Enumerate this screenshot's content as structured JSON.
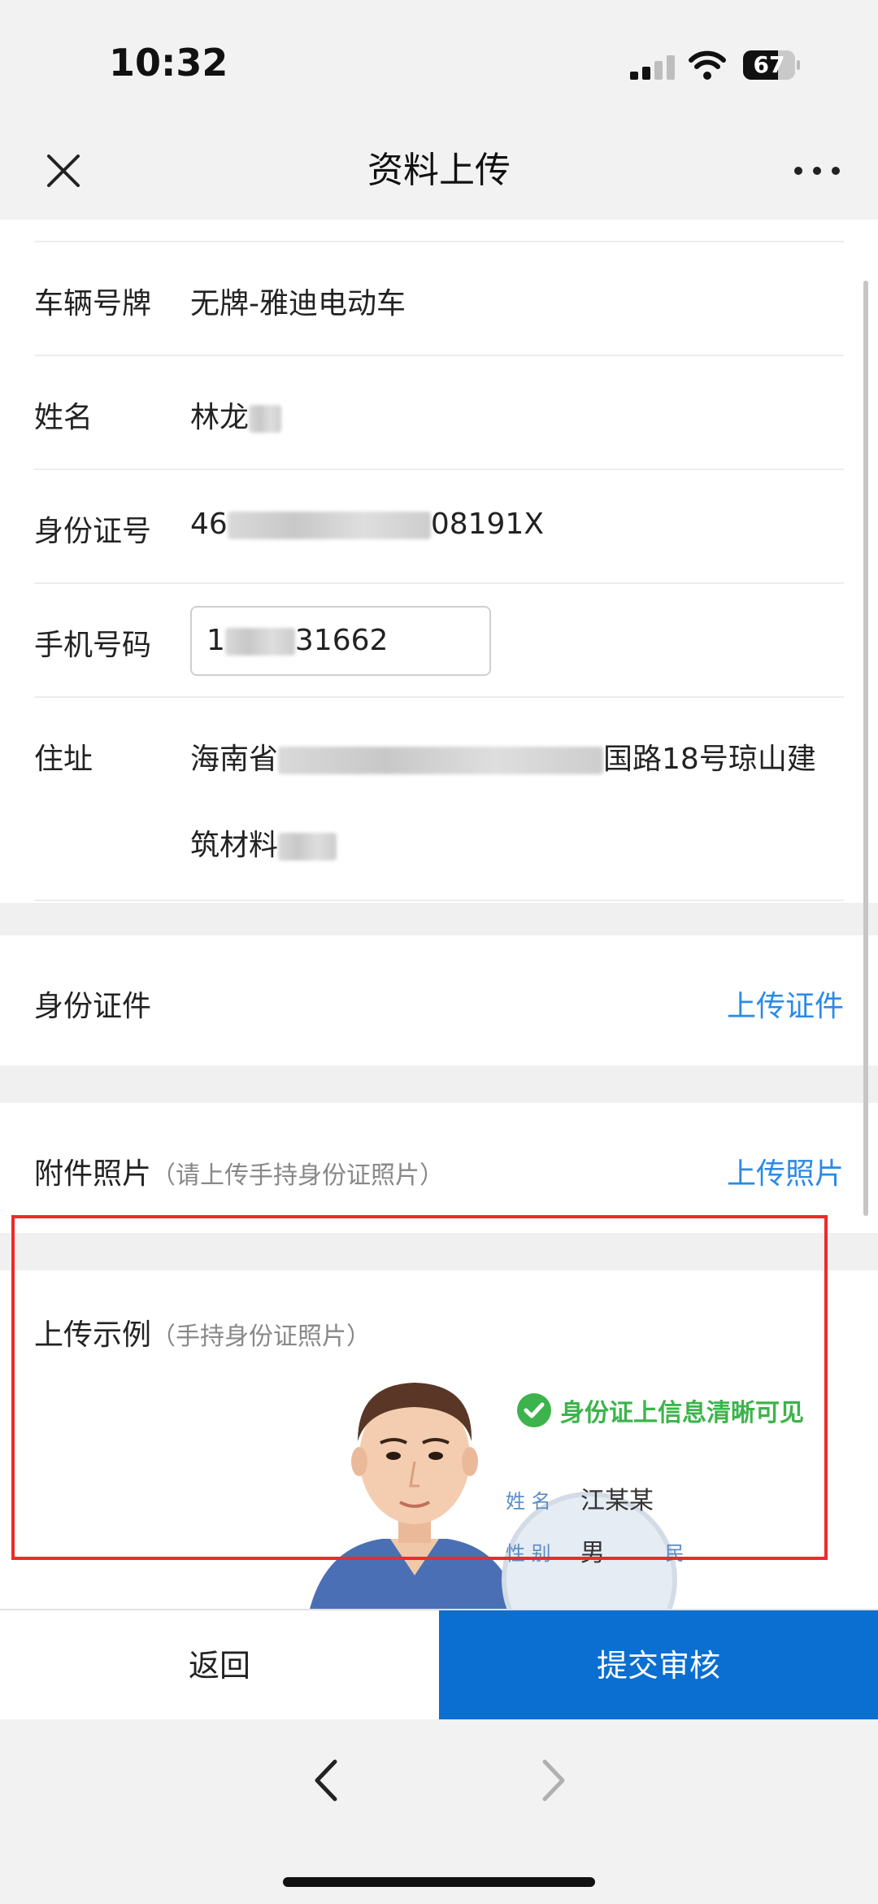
{
  "status_bar": {
    "time": "10:32",
    "battery": "67",
    "battery_level": 0.67
  },
  "nav": {
    "title": "资料上传"
  },
  "form": {
    "plate": {
      "label": "车辆号牌",
      "value": "无牌-雅迪电动车"
    },
    "name": {
      "label": "姓名",
      "value_visible": "林龙"
    },
    "id_number": {
      "label": "身份证号",
      "prefix": "46",
      "suffix": "08191X"
    },
    "phone": {
      "label": "手机号码",
      "prefix": "1",
      "suffix": "31662"
    },
    "address": {
      "label": "住址",
      "line1_prefix": "海南省",
      "line1_suffix": "国路18号琼山建",
      "line2_prefix": "筑材料"
    }
  },
  "id_doc": {
    "label": "身份证件",
    "action": "上传证件"
  },
  "attachment": {
    "label": "附件照片",
    "hint": "（请上传手持身份证照片）",
    "action": "上传照片"
  },
  "example": {
    "label": "上传示例",
    "hint": "（手持身份证照片）",
    "check_text": "身份证上信息清晰可见",
    "card_name_label": "姓 名",
    "card_name_value": "江某某",
    "card_gender_label": "性 别",
    "card_gender_value": "男",
    "card_ethnicity_label": "民"
  },
  "bottom": {
    "back": "返回",
    "submit": "提交审核"
  },
  "colors": {
    "accent": "#0a6fd0",
    "link": "#2a8ae6",
    "highlight": "#ee2a2a",
    "check": "#3cb44b"
  }
}
